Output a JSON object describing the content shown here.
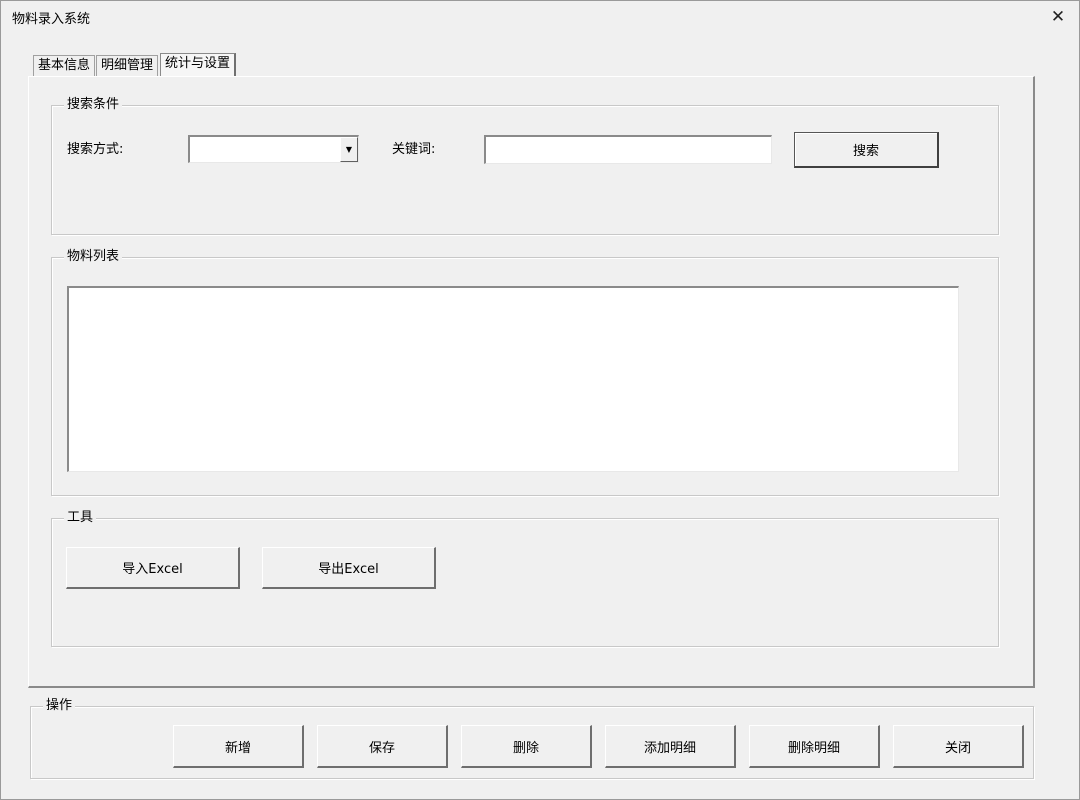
{
  "window": {
    "title": "物料录入系统"
  },
  "tabs": [
    {
      "label": "基本信息"
    },
    {
      "label": "明细管理"
    },
    {
      "label": "统计与设置",
      "active": true
    }
  ],
  "search": {
    "group_title": "搜索条件",
    "method_label": "搜索方式:",
    "method_value": "",
    "keyword_label": "关键词:",
    "keyword_value": "",
    "search_button": "搜索"
  },
  "material_list": {
    "group_title": "物料列表",
    "items": []
  },
  "tools": {
    "group_title": "工具",
    "import_button": "导入Excel",
    "export_button": "导出Excel"
  },
  "operations": {
    "group_title": "操作",
    "buttons": [
      "新增",
      "保存",
      "删除",
      "添加明细",
      "删除明细",
      "关闭"
    ]
  },
  "icons": {
    "close": "close-icon",
    "dropdown": "dropdown-arrow-icon"
  }
}
